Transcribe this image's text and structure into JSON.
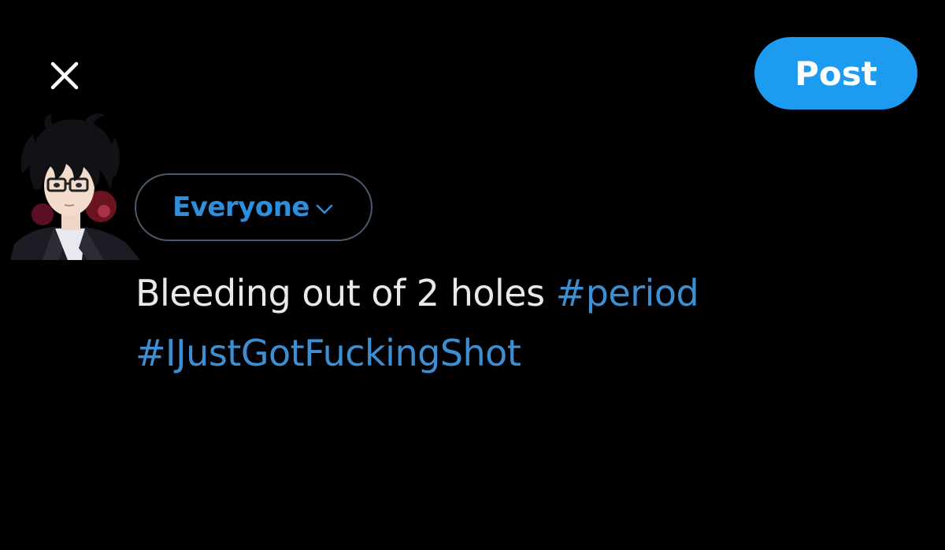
{
  "colors": {
    "background": "#000000",
    "accent": "#1d9bf0",
    "hashtag": "#3d8fd4",
    "body_text": "#e7e9ea",
    "audience_text": "#2e8fde",
    "pill_border": "#4a5a6a"
  },
  "header": {
    "close_icon": "close-icon",
    "post_label": "Post"
  },
  "composer": {
    "avatar": "avatar-anime-character",
    "audience": {
      "label": "Everyone",
      "icon": "chevron-down-icon"
    },
    "text": {
      "plain": "Bleeding out of 2 holes ",
      "hashtag_1": "#period",
      "hashtag_2": "#IJustGotFuckingShot"
    }
  }
}
